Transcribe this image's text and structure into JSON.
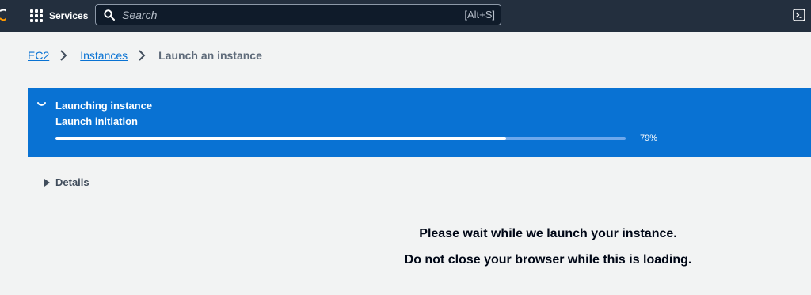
{
  "header": {
    "services_label": "Services",
    "search": {
      "placeholder": "Search",
      "shortcut": "[Alt+S]"
    },
    "icons": [
      "aws-logo",
      "services-grid-icon",
      "search-icon",
      "cloudshell-icon"
    ]
  },
  "breadcrumb": {
    "items": [
      {
        "label": "EC2",
        "link": true
      },
      {
        "label": "Instances",
        "link": true
      },
      {
        "label": "Launch an instance",
        "link": false
      }
    ]
  },
  "flashbar": {
    "title": "Launching instance",
    "subtitle": "Launch initiation",
    "progress": 79,
    "progress_label": "79%",
    "color": "#0972d3"
  },
  "details": {
    "label": "Details"
  },
  "message": {
    "line1": "Please wait while we launch your instance.",
    "line2": "Do not close your browser while this is loading."
  },
  "colors": {
    "topbar": "#232f3e",
    "link": "#0972d3",
    "background": "#f2f3f3"
  }
}
